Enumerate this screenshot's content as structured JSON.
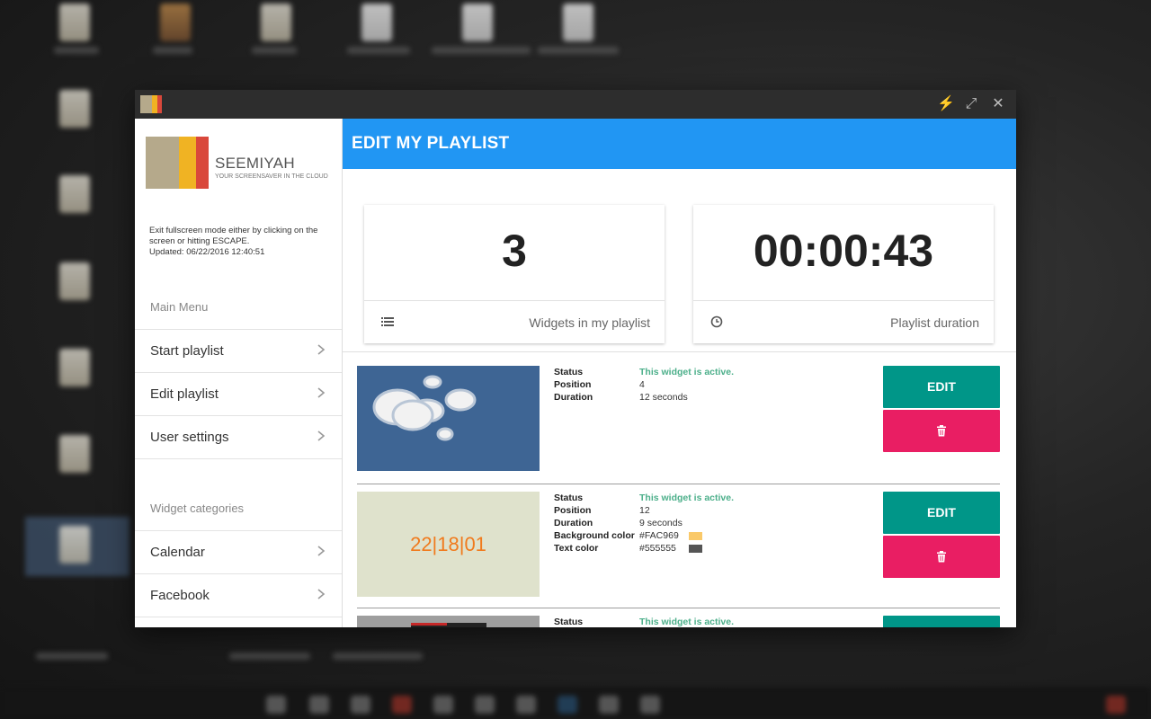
{
  "desktop": {
    "colors": {
      "taskbar": "#151515"
    }
  },
  "window": {
    "title_icon": "seemiyah-logo-icon",
    "controls": [
      {
        "name": "flash-icon",
        "glyph": "⚡"
      },
      {
        "name": "expand-icon",
        "glyph": "⤢"
      },
      {
        "name": "close-icon",
        "glyph": "✕"
      }
    ]
  },
  "brand": {
    "name": "SEEMIYAH",
    "tagline": "YOUR SCREENSAVER IN THE CLOUD",
    "colors": [
      "#b5a98b",
      "#f0b323",
      "#d9483b"
    ]
  },
  "sidebar": {
    "info_line1": "Exit fullscreen mode either by clicking on the screen or hitting ESCAPE.",
    "info_line2": "Updated: 06/22/2016 12:40:51",
    "main_menu_label": "Main Menu",
    "main_menu": [
      {
        "label": "Start playlist"
      },
      {
        "label": "Edit playlist"
      },
      {
        "label": "User settings"
      }
    ],
    "categories_label": "Widget categories",
    "categories": [
      {
        "label": "Calendar"
      },
      {
        "label": "Facebook"
      }
    ]
  },
  "header": {
    "title": "EDIT MY PLAYLIST",
    "color": "#2196F3"
  },
  "stats": {
    "widgets": {
      "value": "3",
      "label": "Widgets in my playlist",
      "icon": "list-icon"
    },
    "duration": {
      "value": "00:00:43",
      "label": "Playlist duration",
      "icon": "clock-icon"
    }
  },
  "labels": {
    "status": "Status",
    "position": "Position",
    "duration": "Duration",
    "bg_color": "Background color",
    "text_color": "Text color",
    "edit": "EDIT"
  },
  "widgets": [
    {
      "status": "This widget is active.",
      "position": "4",
      "duration": "12 seconds",
      "thumbnail": "clouds"
    },
    {
      "status": "This widget is active.",
      "position": "12",
      "duration": "9 seconds",
      "background_color": "#FAC969",
      "text_color": "#555555",
      "thumbnail_text": "22|18|01"
    },
    {
      "status": "This widget is active."
    }
  ],
  "buttons": {
    "edit_color": "#009688",
    "delete_color": "#E91E63",
    "delete_icon": "trash-icon"
  }
}
